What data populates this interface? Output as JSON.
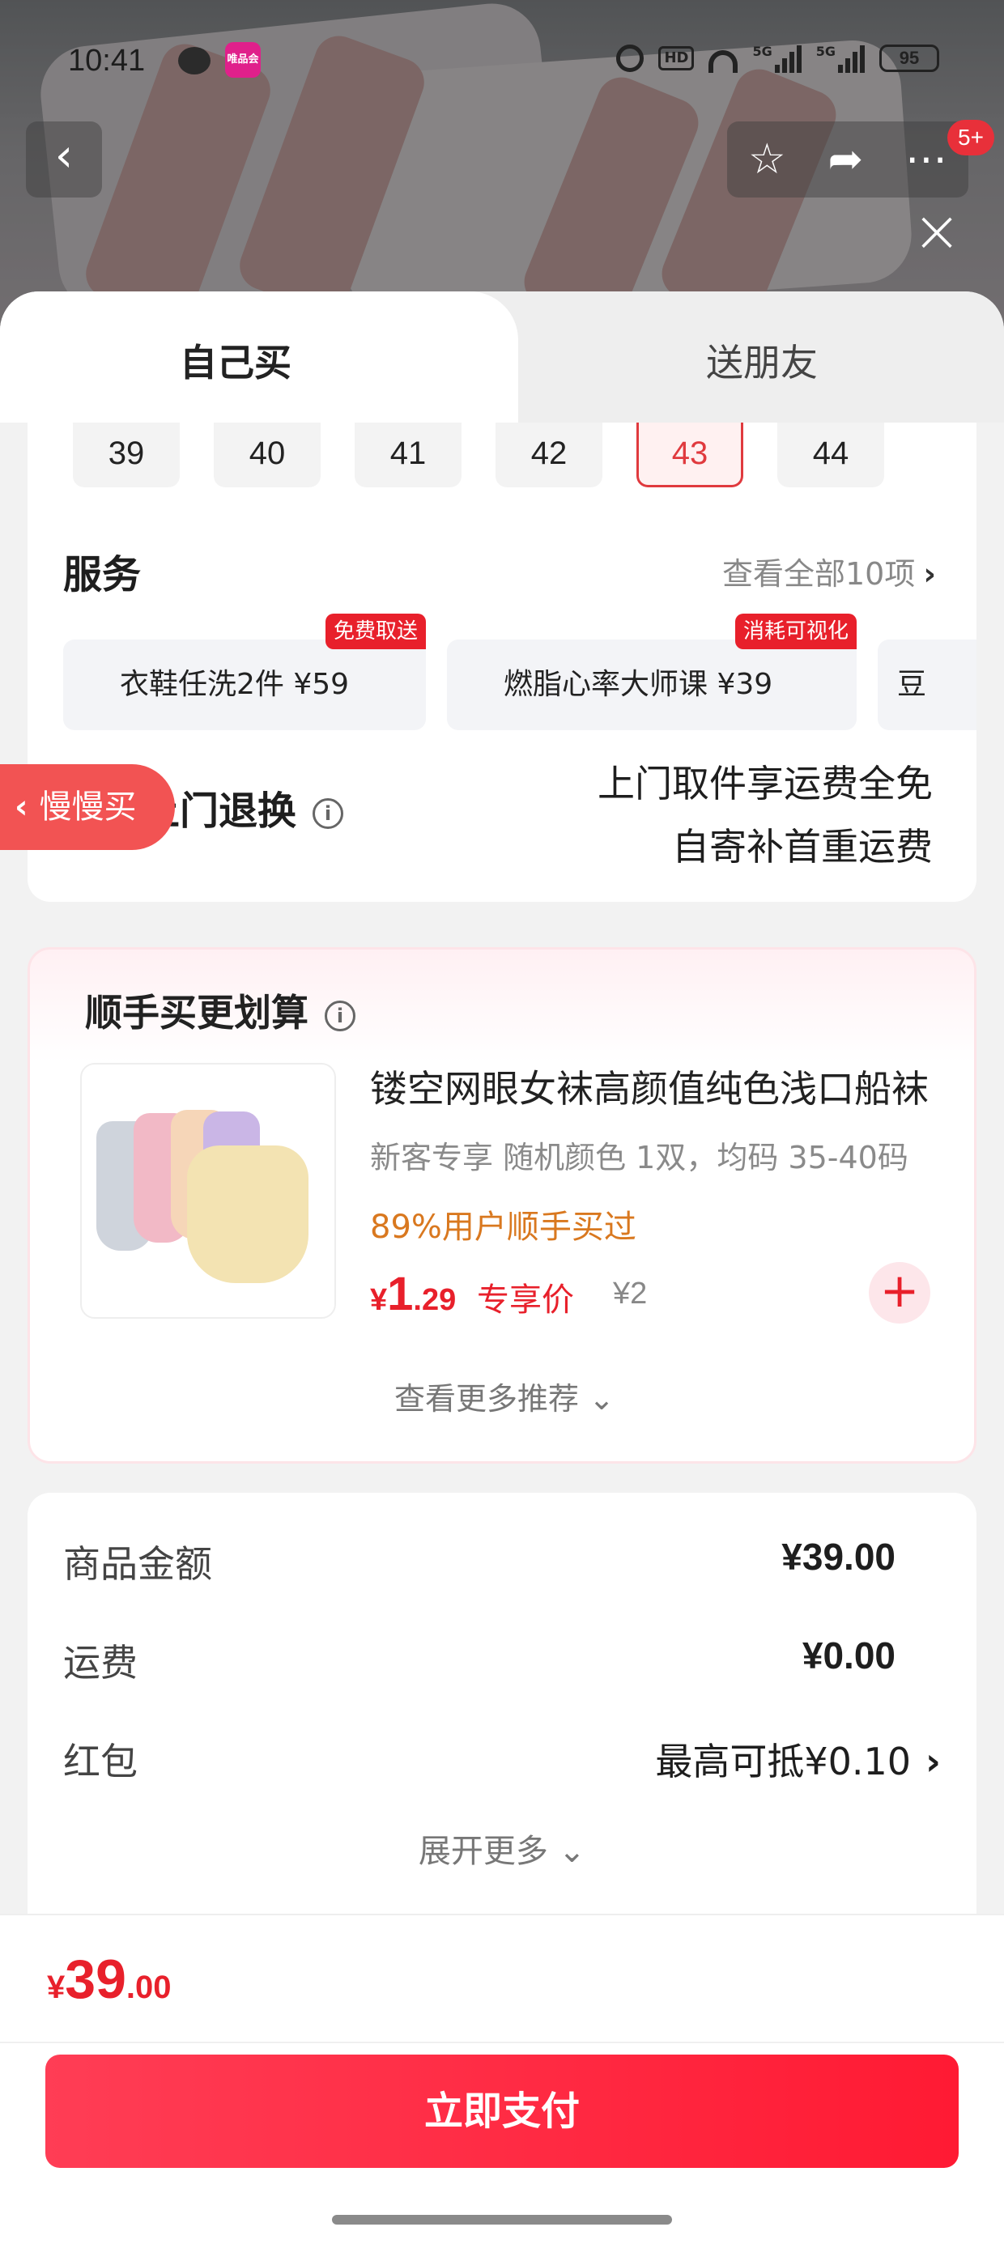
{
  "status_bar": {
    "time": "10:41",
    "app_badge": "唯品会",
    "network_1": "5G",
    "network_2": "5G",
    "hd_label": "HD",
    "battery": "95"
  },
  "nav": {
    "back_icon": "chevron-left-icon",
    "favorite_icon": "star-icon",
    "share_icon": "share-icon",
    "more_icon": "more-icon",
    "more_badge": "5+",
    "close_icon": "close-icon"
  },
  "tabs": {
    "self": "自己买",
    "friend": "送朋友"
  },
  "sizes": [
    {
      "label": "39",
      "selected": false
    },
    {
      "label": "40",
      "selected": false
    },
    {
      "label": "41",
      "selected": false
    },
    {
      "label": "42",
      "selected": false
    },
    {
      "label": "43",
      "selected": true
    },
    {
      "label": "44",
      "selected": false
    }
  ],
  "services": {
    "title": "服务",
    "view_all": "查看全部10项",
    "items": [
      {
        "label": "衣鞋任洗2件  ¥59",
        "badge": "免费取送"
      },
      {
        "label": "燃脂心率大师课  ¥39",
        "badge": "消耗可视化"
      },
      {
        "label": "豆",
        "badge": ""
      }
    ]
  },
  "returns": {
    "label": "免费上门退换",
    "line1": "上门取件享运费全免",
    "line2": "自寄补首重运费"
  },
  "slow_buy": "慢慢买",
  "addon": {
    "title": "顺手买更划算",
    "product_name": "镂空网眼女袜高颜值纯色浅口船袜",
    "spec": "新客专享  随机颜色 1双，均码 35-40码",
    "social_proof": "89%用户顺手买过",
    "price_currency": "¥",
    "price_int": "1",
    "price_dec": ".29",
    "price_tag": "专享价",
    "original_price": "¥2",
    "see_more": "查看更多推荐 ⌄"
  },
  "summary": {
    "rows": [
      {
        "label": "商品金额",
        "value": "¥39.00"
      },
      {
        "label": "运费",
        "value": "¥0.00"
      },
      {
        "label": "红包",
        "value": "最高可抵¥0.10"
      }
    ],
    "expand": "展开更多 ⌄"
  },
  "footer": {
    "total_currency": "¥",
    "total_int": "39",
    "total_dec": ".00",
    "pay_button": "立即支付"
  },
  "colors": {
    "accent": "#e8202b",
    "pay_button": "#ff2a42",
    "social_proof": "#d9781f"
  }
}
